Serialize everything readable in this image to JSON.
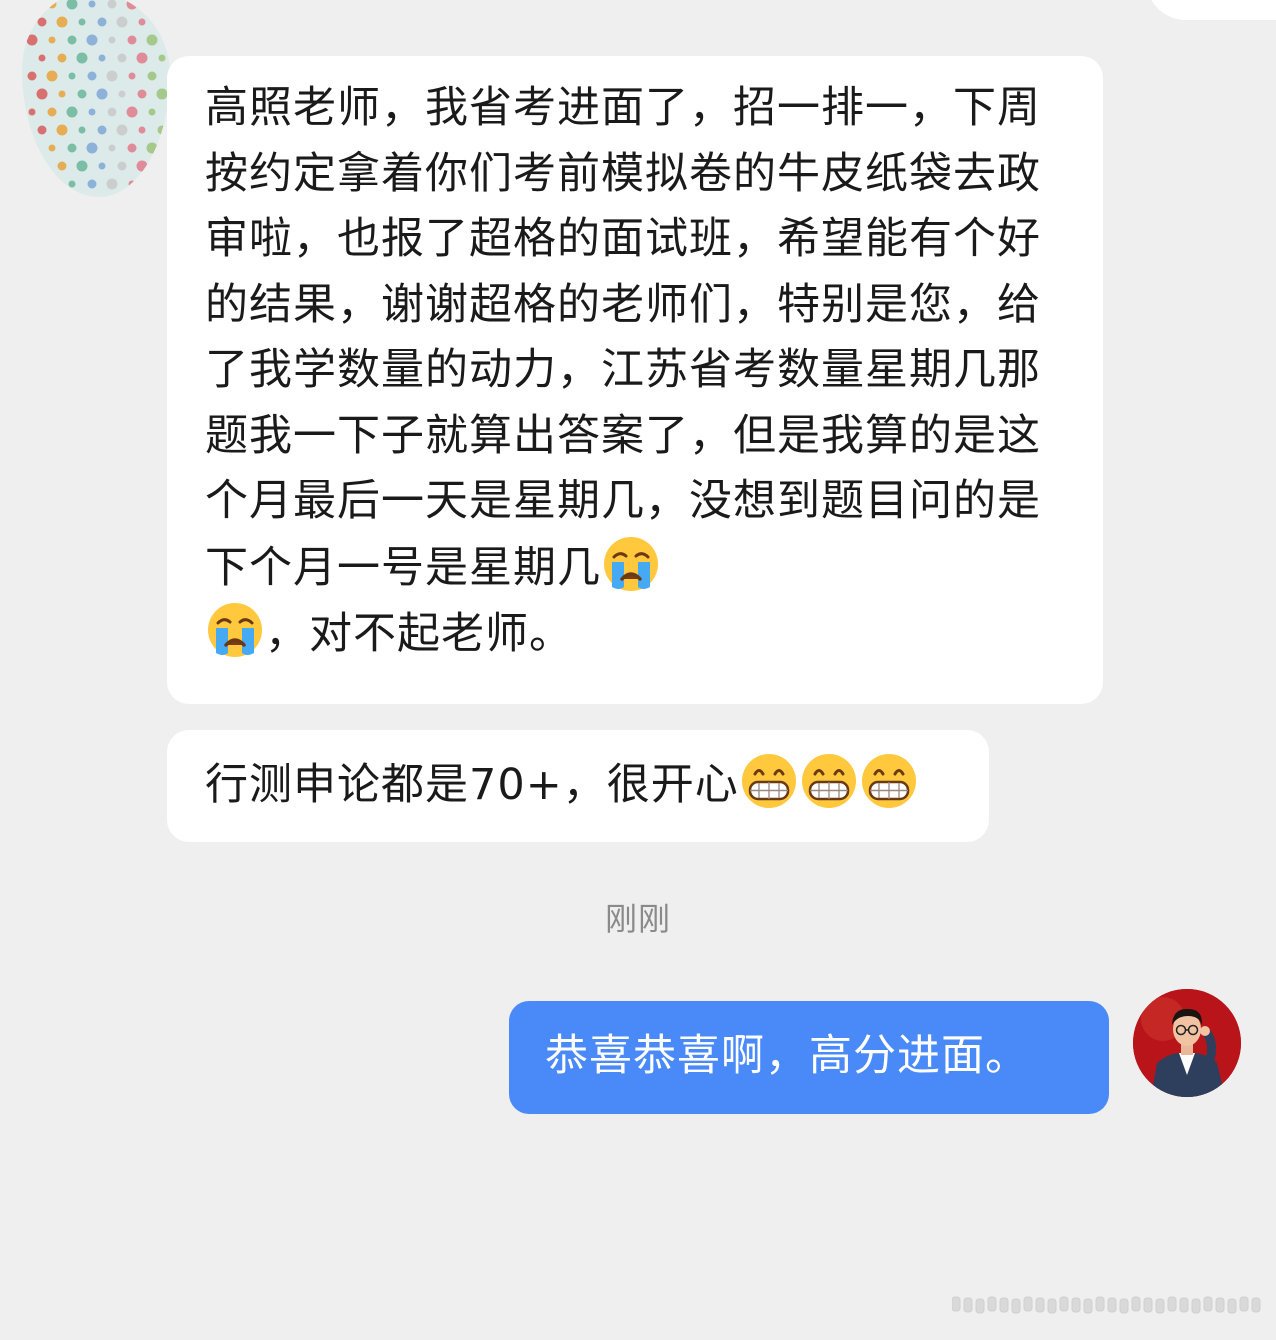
{
  "conversation": {
    "incoming": [
      {
        "text": "高照老师，我省考进面了，招一排一，下周按约定拿着你们考前模拟卷的牛皮纸袋去政审啦，也报了超格的面试班，希望能有个好的结果，谢谢超格的老师们，特别是您，给了我学数量的动力，江苏省考数量星期几那题我一下子就算出答案了，但是我算的是这个月最后一天是星期几，没想到题目问的是下个月一号是星期几",
        "emoji": "loudly-crying-face",
        "tail": "，对不起老师。"
      },
      {
        "text": "行测申论都是70+，很开心",
        "emoji": "grinning-face-with-smiling-eyes"
      }
    ],
    "timestamp": "刚刚",
    "outgoing": [
      {
        "text": "恭喜恭喜啊，高分进面。"
      }
    ]
  },
  "colors": {
    "background": "#efefef",
    "incoming_bubble": "#ffffff",
    "outgoing_bubble": "#4a8af8",
    "timestamp_text": "#8a8a8a"
  }
}
